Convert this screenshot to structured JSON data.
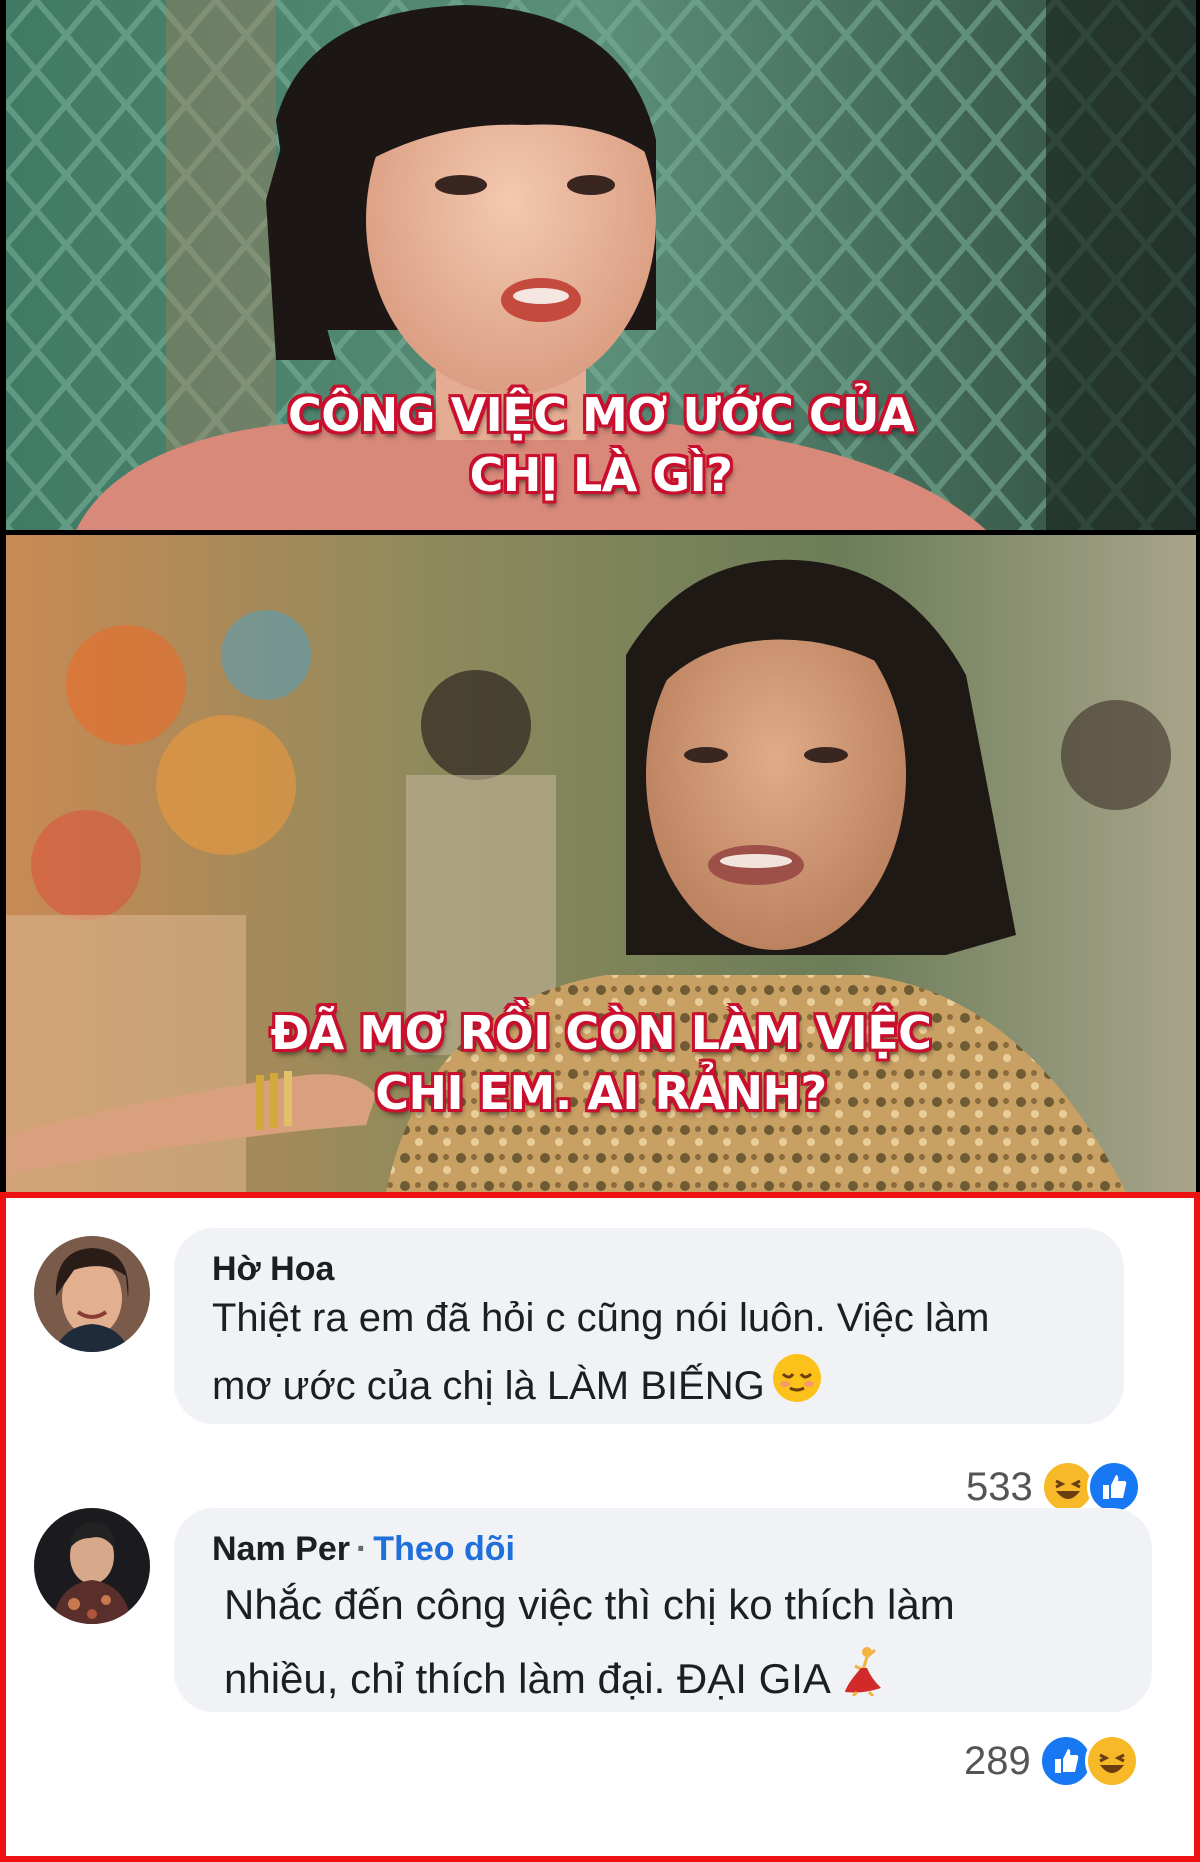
{
  "meme": {
    "panel1_caption": [
      "CÔNG VIỆC MƠ ƯỚC CỦA",
      "CHỊ LÀ GÌ?"
    ],
    "panel2_caption": [
      "ĐÃ MƠ RỒI CÒN LÀM VIỆC",
      "CHI EM. AI RẢNH?"
    ]
  },
  "comments": [
    {
      "author": "Hờ Hoa",
      "text_lines": [
        "Thiệt ra em đã hỏi c cũng nói luôn. Việc làm",
        "mơ ước của chị là LÀM BIẾNG"
      ],
      "emoji": "relieved-face",
      "reaction_count": "533",
      "reactions": [
        "haha",
        "like"
      ]
    },
    {
      "author": "Nam Per",
      "separator": "·",
      "follow_label": "Theo dõi",
      "text_lines": [
        "Nhắc đến công việc thì chị ko thích làm",
        "nhiều, chỉ thích làm đại. ĐẠI GIA"
      ],
      "emoji": "dancing-woman",
      "reaction_count": "289",
      "reactions": [
        "like",
        "haha"
      ]
    }
  ],
  "colors": {
    "caption_outline": "#c8102e",
    "frame_border": "#ee1111",
    "bubble_bg": "#f0f2f5",
    "follow_link": "#216fdb",
    "like_blue": "#1877f2",
    "haha_yellow": "#f7b928"
  }
}
